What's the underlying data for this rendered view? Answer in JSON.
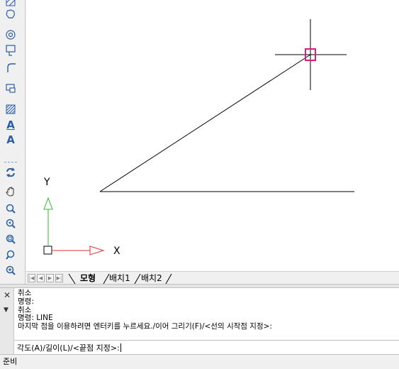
{
  "toolbar": {
    "tools": [
      {
        "icon": "hatch-partial-icon"
      },
      {
        "icon": "revision-cloud-icon"
      },
      {
        "icon": "donut-icon"
      },
      {
        "icon": "region-icon"
      },
      {
        "icon": "fillet-icon"
      },
      {
        "icon": "block-icon"
      },
      {
        "icon": "hatch-icon"
      },
      {
        "icon": "text-icon",
        "glyph": "A"
      },
      {
        "icon": "multiline-text-icon",
        "glyph": "A"
      },
      {
        "icon": "regen-icon"
      },
      {
        "icon": "pan-icon"
      },
      {
        "icon": "zoom-icon"
      },
      {
        "icon": "zoom-previous-icon"
      },
      {
        "icon": "zoom-window-icon"
      },
      {
        "icon": "zoom-realtime-icon"
      },
      {
        "icon": "zoom-in-icon"
      }
    ]
  },
  "canvas": {
    "ucs": {
      "y_label": "Y",
      "x_label": "X"
    }
  },
  "tabs": {
    "items": [
      {
        "label": "모형",
        "active": true
      },
      {
        "label": "배치1",
        "active": false
      },
      {
        "label": "배치2",
        "active": false
      }
    ]
  },
  "command": {
    "history": [
      "취소",
      "명령:",
      "취소",
      "명령: LINE",
      "마지막 점을 이용하려면 엔터키를 누르세요./이어 그리기(F)/<선의 시작점 지정>:"
    ],
    "prompt": "각도(A)/길이(L)/<끝점 지정>:"
  },
  "status": {
    "text": "준비"
  },
  "colors": {
    "toolbar_icon": "#2a5fa8",
    "ucs_y_axis": "#22c422",
    "ucs_x_axis": "#e03030",
    "cursor_box": "#e0197a",
    "drawing_line": "#000000"
  }
}
